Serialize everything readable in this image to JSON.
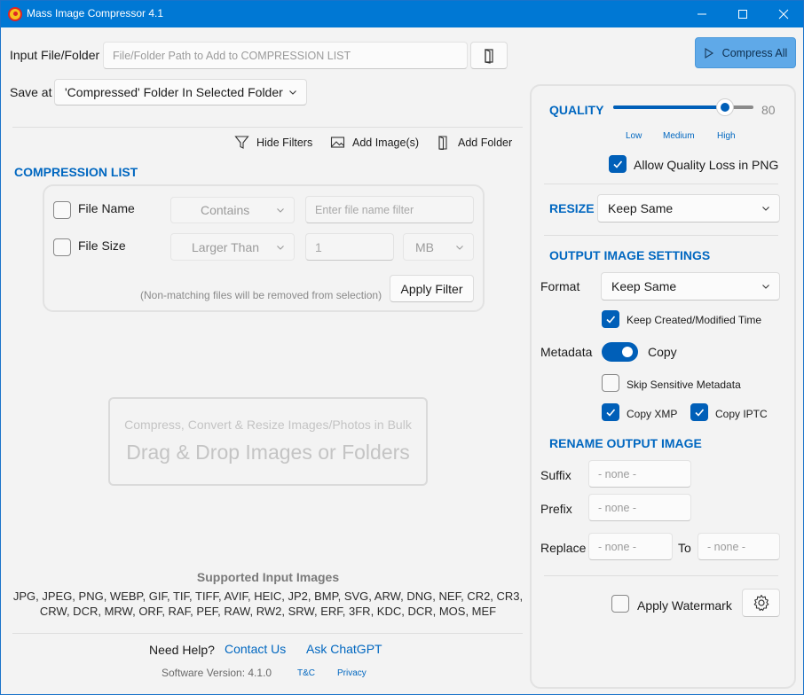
{
  "window": {
    "title": "Mass Image Compressor 4.1"
  },
  "input": {
    "label": "Input File/Folder",
    "placeholder": "File/Folder Path to Add to COMPRESSION LIST"
  },
  "save": {
    "label": "Save at",
    "value": "'Compressed' Folder In Selected Folder"
  },
  "compress_all": "Compress All",
  "toolbar": {
    "hide_filters": "Hide Filters",
    "add_images": "Add Image(s)",
    "add_folder": "Add Folder"
  },
  "compression_list": {
    "title": "COMPRESSION LIST"
  },
  "filters": {
    "file_name": {
      "label": "File Name",
      "mode": "Contains",
      "placeholder": "Enter file name filter"
    },
    "file_size": {
      "label": "File Size",
      "mode": "Larger Than",
      "value": "1",
      "unit": "MB"
    },
    "note": "(Non-matching files will be removed from selection)",
    "apply": "Apply Filter"
  },
  "dropzone": {
    "subtitle": "Compress, Convert & Resize Images/Photos in Bulk",
    "title": "Drag & Drop Images or Folders"
  },
  "supported": {
    "title": "Supported Input Images",
    "line1": "JPG, JPEG, PNG, WEBP, GIF, TIF, TIFF, AVIF, HEIC, JP2, BMP, SVG, ARW, DNG, NEF, CR2, CR3,",
    "line2": "CRW, DCR, MRW, ORF, RAF, PEF, RAW, RW2, SRW, ERF, 3FR, KDC, DCR, MOS, MEF"
  },
  "footer": {
    "need_help": "Need Help?",
    "contact": "Contact Us",
    "chatgpt": "Ask ChatGPT",
    "version": "Software Version: 4.1.0",
    "tnc": "T&C",
    "privacy": "Privacy"
  },
  "quality": {
    "title": "QUALITY",
    "value": "80",
    "level": 0.8,
    "low": "Low",
    "medium": "Medium",
    "high": "High",
    "allow_loss": "Allow Quality Loss in PNG"
  },
  "resize": {
    "title": "RESIZE",
    "value": "Keep Same"
  },
  "output": {
    "title": "OUTPUT IMAGE SETTINGS",
    "format_label": "Format",
    "format_value": "Keep Same",
    "keep_time": "Keep Created/Modified Time",
    "metadata_label": "Metadata",
    "metadata_value": "Copy",
    "skip_sensitive": "Skip Sensitive Metadata",
    "copy_xmp": "Copy XMP",
    "copy_iptc": "Copy IPTC"
  },
  "rename": {
    "title": "RENAME OUTPUT IMAGE",
    "suffix_label": "Suffix",
    "prefix_label": "Prefix",
    "replace_label": "Replace",
    "to_label": "To",
    "none": "- none -"
  },
  "watermark": {
    "label": "Apply Watermark"
  },
  "colors": {
    "accent": "#0067c0",
    "titlebar": "#0078d4",
    "primary_button": "#5fa9e8"
  }
}
